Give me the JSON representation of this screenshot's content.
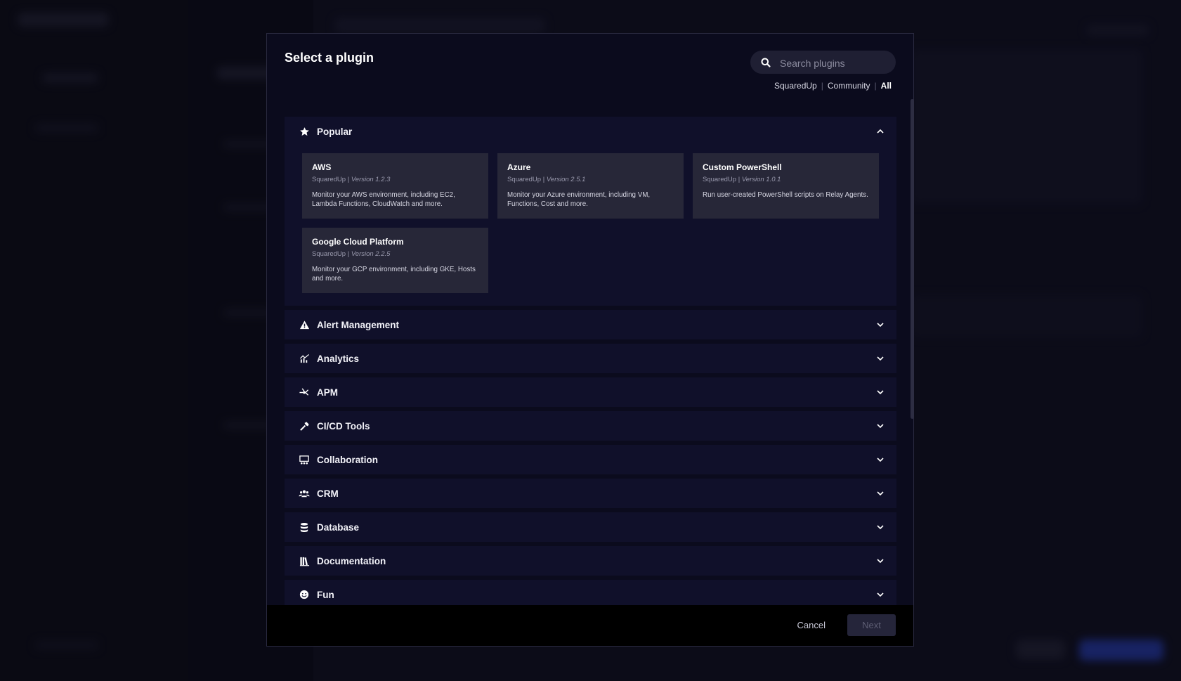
{
  "modal": {
    "title": "Select a plugin",
    "search_placeholder": "Search plugins",
    "filters": [
      "SquaredUp",
      "Community",
      "All"
    ],
    "active_filter": "All"
  },
  "popular": {
    "label": "Popular",
    "icon": "star-icon",
    "cards": [
      {
        "name": "AWS",
        "publisher": "SquaredUp",
        "version": "Version 1.2.3",
        "description": "Monitor your AWS environment, including EC2, Lambda Functions, CloudWatch and more."
      },
      {
        "name": "Azure",
        "publisher": "SquaredUp",
        "version": "Version 2.5.1",
        "description": "Monitor your Azure environment, including VM, Functions, Cost and more."
      },
      {
        "name": "Custom PowerShell",
        "publisher": "SquaredUp",
        "version": "Version 1.0.1",
        "description": "Run user-created PowerShell scripts on Relay Agents."
      },
      {
        "name": "Google Cloud Platform",
        "publisher": "SquaredUp",
        "version": "Version 2.2.5",
        "description": "Monitor your GCP environment, including GKE, Hosts and more."
      }
    ]
  },
  "categories": [
    {
      "label": "Alert Management",
      "icon": "warning-icon"
    },
    {
      "label": "Analytics",
      "icon": "analytics-icon"
    },
    {
      "label": "APM",
      "icon": "apm-icon"
    },
    {
      "label": "CI/CD Tools",
      "icon": "hammer-icon"
    },
    {
      "label": "Collaboration",
      "icon": "collaboration-icon"
    },
    {
      "label": "CRM",
      "icon": "users-icon"
    },
    {
      "label": "Database",
      "icon": "database-icon"
    },
    {
      "label": "Documentation",
      "icon": "books-icon"
    },
    {
      "label": "Fun",
      "icon": "smiley-icon"
    }
  ],
  "footer": {
    "cancel": "Cancel",
    "next": "Next"
  }
}
